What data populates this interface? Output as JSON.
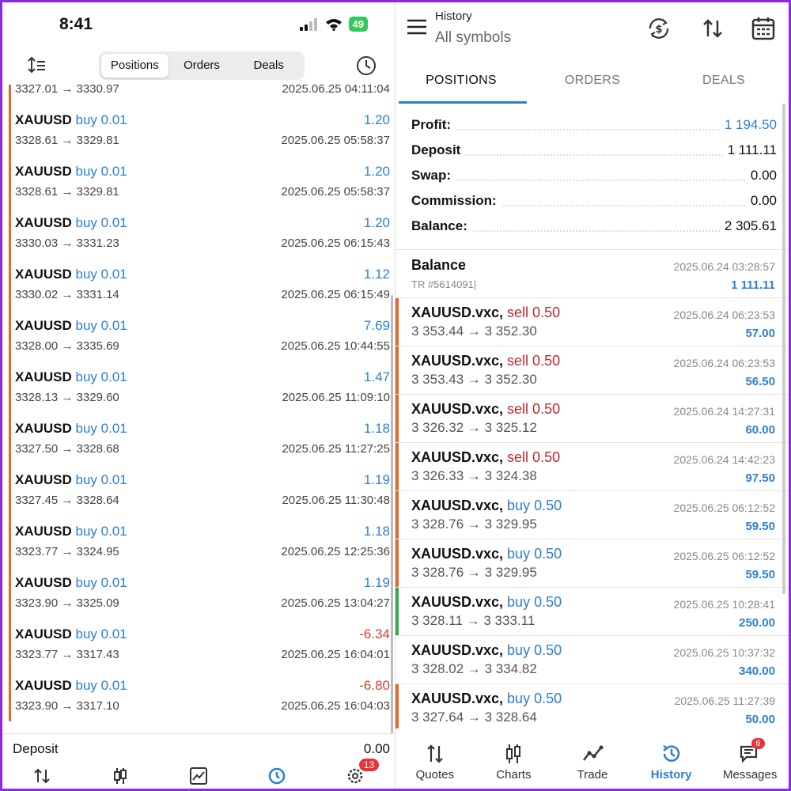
{
  "left": {
    "status": {
      "time": "8:41",
      "battery": "49"
    },
    "segments": [
      "Positions",
      "Orders",
      "Deals"
    ],
    "first_row": {
      "prices": "3327.01 → 3330.97",
      "datetime": "2025.06.25 04:11:04"
    },
    "rows": [
      {
        "symbol": "XAUUSD",
        "side": "buy 0.01",
        "profit": "1.20",
        "prices": "3328.61 → 3329.81",
        "datetime": "2025.06.25 05:58:37",
        "negative": false
      },
      {
        "symbol": "XAUUSD",
        "side": "buy 0.01",
        "profit": "1.20",
        "prices": "3328.61 → 3329.81",
        "datetime": "2025.06.25 05:58:37",
        "negative": false
      },
      {
        "symbol": "XAUUSD",
        "side": "buy 0.01",
        "profit": "1.20",
        "prices": "3330.03 → 3331.23",
        "datetime": "2025.06.25 06:15:43",
        "negative": false
      },
      {
        "symbol": "XAUUSD",
        "side": "buy 0.01",
        "profit": "1.12",
        "prices": "3330.02 → 3331.14",
        "datetime": "2025.06.25 06:15:49",
        "negative": false
      },
      {
        "symbol": "XAUUSD",
        "side": "buy 0.01",
        "profit": "7.69",
        "prices": "3328.00 → 3335.69",
        "datetime": "2025.06.25 10:44:55",
        "negative": false
      },
      {
        "symbol": "XAUUSD",
        "side": "buy 0.01",
        "profit": "1.47",
        "prices": "3328.13 → 3329.60",
        "datetime": "2025.06.25 11:09:10",
        "negative": false
      },
      {
        "symbol": "XAUUSD",
        "side": "buy 0.01",
        "profit": "1.18",
        "prices": "3327.50 → 3328.68",
        "datetime": "2025.06.25 11:27:25",
        "negative": false
      },
      {
        "symbol": "XAUUSD",
        "side": "buy 0.01",
        "profit": "1.19",
        "prices": "3327.45 → 3328.64",
        "datetime": "2025.06.25 11:30:48",
        "negative": false
      },
      {
        "symbol": "XAUUSD",
        "side": "buy 0.01",
        "profit": "1.18",
        "prices": "3323.77 → 3324.95",
        "datetime": "2025.06.25 12:25:36",
        "negative": false
      },
      {
        "symbol": "XAUUSD",
        "side": "buy 0.01",
        "profit": "1.19",
        "prices": "3323.90 → 3325.09",
        "datetime": "2025.06.25 13:04:27",
        "negative": false
      },
      {
        "symbol": "XAUUSD",
        "side": "buy 0.01",
        "profit": "-6.34",
        "prices": "3323.77 → 3317.43",
        "datetime": "2025.06.25 16:04:01",
        "negative": true
      },
      {
        "symbol": "XAUUSD",
        "side": "buy 0.01",
        "profit": "-6.80",
        "prices": "3323.90 → 3317.10",
        "datetime": "2025.06.25 16:04:03",
        "negative": true
      }
    ],
    "deposit": {
      "label": "Deposit",
      "value": "0.00"
    },
    "tab_badge": "13"
  },
  "right": {
    "appbar": {
      "title": "History",
      "subtitle": "All symbols"
    },
    "tabs": [
      "POSITIONS",
      "ORDERS",
      "DEALS"
    ],
    "summary": [
      {
        "label": "Profit:",
        "value": "1 194.50",
        "blue": true
      },
      {
        "label": "Deposit",
        "value": "1 111.11",
        "blue": false
      },
      {
        "label": "Swap:",
        "value": "0.00",
        "blue": false
      },
      {
        "label": "Commission:",
        "value": "0.00",
        "blue": false
      },
      {
        "label": "Balance:",
        "value": "2 305.61",
        "blue": false
      }
    ],
    "balance_row": {
      "title": "Balance",
      "ticket": "TR #5614091|",
      "datetime": "2025.06.24 03:28:57",
      "amount": "1 111.11"
    },
    "rows": [
      {
        "symbol": "XAUUSD.vxc,",
        "side": "sell 0.50",
        "type": "sell",
        "prices": "3 353.44 → 3 352.30",
        "datetime": "2025.06.24 06:23:53",
        "amount": "57.00",
        "bar": "orange"
      },
      {
        "symbol": "XAUUSD.vxc,",
        "side": "sell 0.50",
        "type": "sell",
        "prices": "3 353.43 → 3 352.30",
        "datetime": "2025.06.24 06:23:53",
        "amount": "56.50",
        "bar": "orange"
      },
      {
        "symbol": "XAUUSD.vxc,",
        "side": "sell 0.50",
        "type": "sell",
        "prices": "3 326.32 → 3 325.12",
        "datetime": "2025.06.24 14:27:31",
        "amount": "60.00",
        "bar": "orange"
      },
      {
        "symbol": "XAUUSD.vxc,",
        "side": "sell 0.50",
        "type": "sell",
        "prices": "3 326.33 → 3 324.38",
        "datetime": "2025.06.24 14:42:23",
        "amount": "97.50",
        "bar": "orange"
      },
      {
        "symbol": "XAUUSD.vxc,",
        "side": "buy 0.50",
        "type": "buy",
        "prices": "3 328.76 → 3 329.95",
        "datetime": "2025.06.25 06:12:52",
        "amount": "59.50",
        "bar": "orange"
      },
      {
        "symbol": "XAUUSD.vxc,",
        "side": "buy 0.50",
        "type": "buy",
        "prices": "3 328.76 → 3 329.95",
        "datetime": "2025.06.25 06:12:52",
        "amount": "59.50",
        "bar": "orange"
      },
      {
        "symbol": "XAUUSD.vxc,",
        "side": "buy 0.50",
        "type": "buy",
        "prices": "3 328.11 → 3 333.11",
        "datetime": "2025.06.25 10:28:41",
        "amount": "250.00",
        "bar": "green"
      },
      {
        "symbol": "XAUUSD.vxc,",
        "side": "buy 0.50",
        "type": "buy",
        "prices": "3 328.02 → 3 334.82",
        "datetime": "2025.06.25 10:37:32",
        "amount": "340.00",
        "bar": "none"
      },
      {
        "symbol": "XAUUSD.vxc,",
        "side": "buy 0.50",
        "type": "buy",
        "prices": "3 327.64 → 3 328.64",
        "datetime": "2025.06.25 11:27:39",
        "amount": "50.00",
        "bar": "orange"
      }
    ],
    "nav": [
      {
        "label": "Quotes",
        "icon": "quotes-icon"
      },
      {
        "label": "Charts",
        "icon": "charts-icon"
      },
      {
        "label": "Trade",
        "icon": "trade-icon"
      },
      {
        "label": "History",
        "icon": "history-icon"
      },
      {
        "label": "Messages",
        "icon": "messages-icon"
      }
    ],
    "messages_badge": "6"
  },
  "colors": {
    "blue": "#2a7fd4",
    "sell_red": "#c0282d",
    "loss_red": "#d9412e",
    "orange_bar": "#e06a2a",
    "green_bar": "#2eaa4c",
    "frame": "#8a2be2"
  }
}
